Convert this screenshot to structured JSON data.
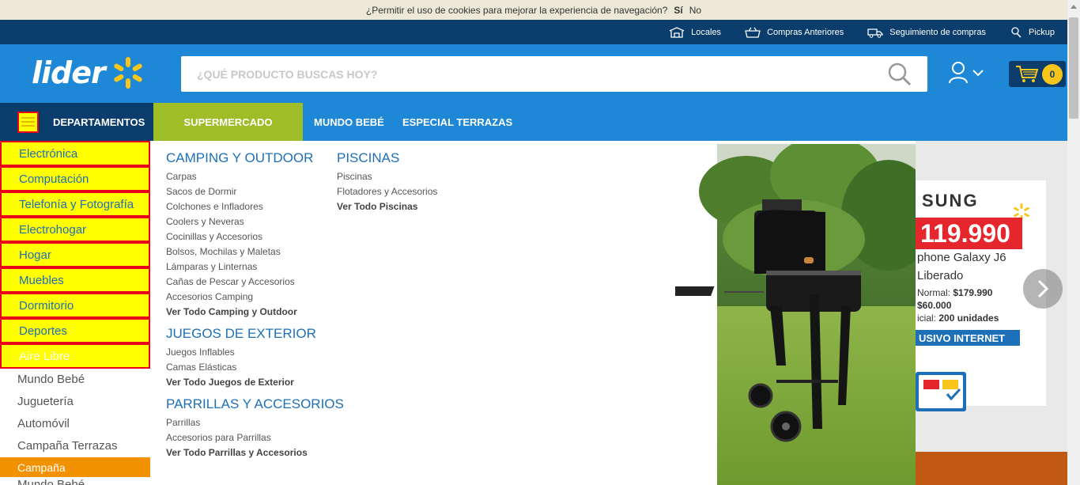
{
  "cookie_bar": {
    "text": "¿Permitir el uso de cookies para mejorar la experiencia de navegación?",
    "yes": "Sí",
    "no": "No"
  },
  "topbar": {
    "links": [
      "Locales",
      "Compras Anteriores",
      "Seguimiento de compras",
      "Pickup"
    ]
  },
  "header": {
    "logo_text": "lider",
    "search_placeholder": "¿QUÉ PRODUCTO BUSCAS HOY?",
    "cart_count": "0"
  },
  "nav": {
    "departments": "DEPARTAMENTOS",
    "items": [
      "SUPERMERCADO",
      "MUNDO BEBÉ",
      "ESPECIAL TERRAZAS"
    ]
  },
  "sidebar": {
    "highlighted": [
      "Electrónica",
      "Computación",
      "Telefonía y Fotografía",
      "Electrohogar",
      "Hogar",
      "Muebles",
      "Dormitorio",
      "Deportes",
      "Aire Libre"
    ],
    "items": [
      "Mundo Bebé",
      "Juguetería",
      "Automóvil",
      "Campaña Terrazas"
    ],
    "campaign": "Campaña",
    "cut_item": "Mundo Bebé"
  },
  "mega": {
    "camping": {
      "title": "CAMPING Y OUTDOOR",
      "links": [
        "Carpas",
        "Sacos de Dormir",
        "Colchones e Infladores",
        "Coolers y Neveras",
        "Cocinillas y Accesorios",
        "Bolsos, Mochilas y Maletas",
        "Lámparas y Linternas",
        "Cañas de Pescar y Accesorios",
        "Accesorios Camping"
      ],
      "view_all": "Ver Todo Camping y Outdoor"
    },
    "juegos": {
      "title": "JUEGOS DE EXTERIOR",
      "links": [
        "Juegos Inflables",
        "Camas Elásticas"
      ],
      "view_all": "Ver Todo Juegos de Exterior"
    },
    "parrillas": {
      "title": "PARRILLAS Y ACCESORIOS",
      "links": [
        "Parrillas",
        "Accesorios para Parrillas"
      ],
      "view_all": "Ver Todo Parrillas y Accesorios"
    },
    "piscinas": {
      "title": "PISCINAS",
      "links": [
        "Piscinas",
        "Flotadores y Accesorios"
      ],
      "view_all": "Ver Todo Piscinas"
    }
  },
  "banner": {
    "brand": "SUNG",
    "price": "119.990",
    "product_line1": "phone Galaxy J6",
    "product_line2": "Liberado",
    "normal_label": "Normal:",
    "normal_price": "$179.990",
    "save": "$60.000",
    "stock_label": "icial:",
    "stock": "200 unidades",
    "tag": "USIVO INTERNET"
  },
  "colors": {
    "primary": "#1e88d6",
    "dark": "#0a3d6b",
    "green": "#9ebd27",
    "yellow": "#ffff00",
    "red": "#e8001c",
    "orange": "#f39200"
  }
}
